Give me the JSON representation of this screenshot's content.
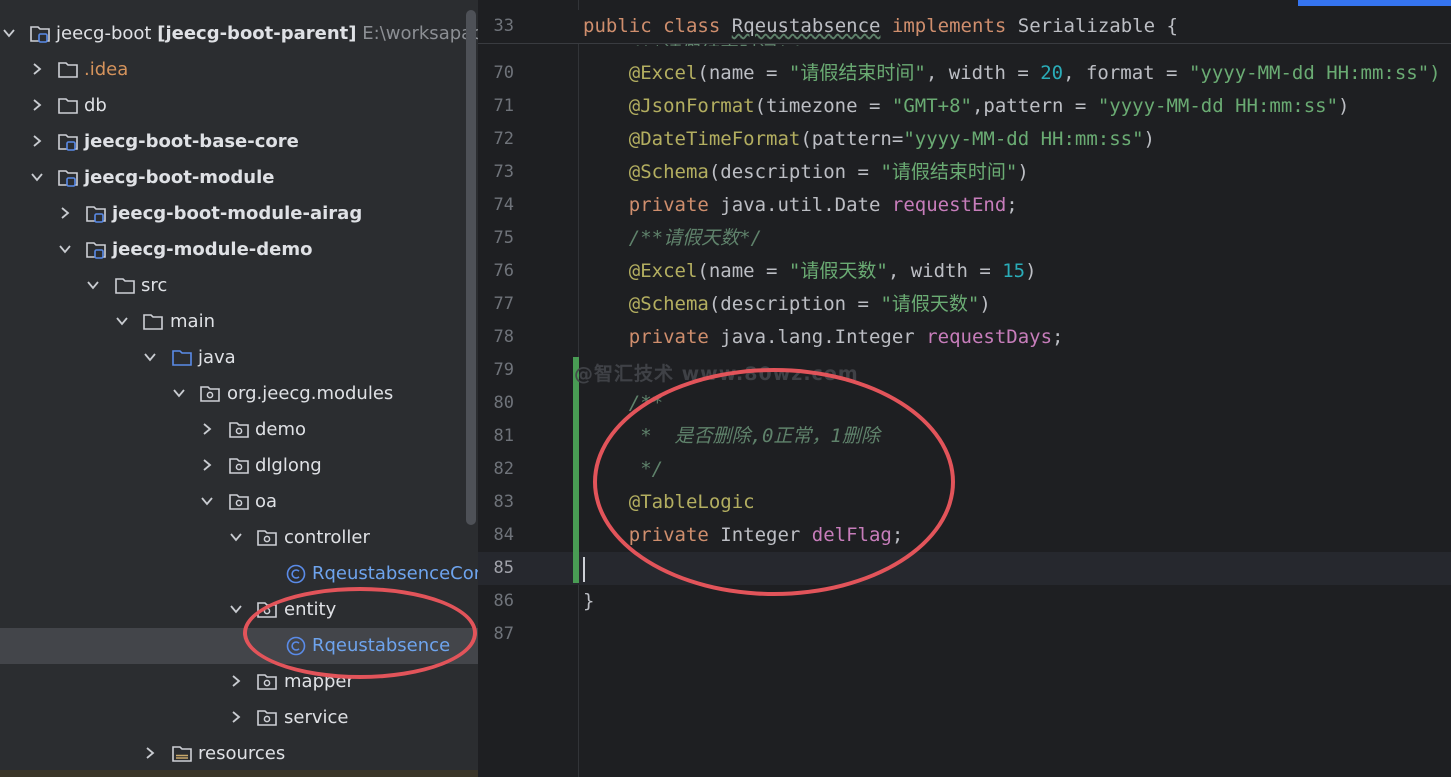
{
  "project_tree": {
    "items": [
      {
        "label": "jeecg-boot",
        "label_suffix": "[jeecg-boot-parent]",
        "path_hint": "E:\\worksapace\\je"
      },
      {
        "label": ".idea"
      },
      {
        "label": "db"
      },
      {
        "label": "jeecg-boot-base-core"
      },
      {
        "label": "jeecg-boot-module"
      },
      {
        "label": "jeecg-boot-module-airag"
      },
      {
        "label": "jeecg-module-demo"
      },
      {
        "label": "src"
      },
      {
        "label": "main"
      },
      {
        "label": "java"
      },
      {
        "label": "org.jeecg.modules"
      },
      {
        "label": "demo"
      },
      {
        "label": "dlglong"
      },
      {
        "label": "oa"
      },
      {
        "label": "controller"
      },
      {
        "label": "RqeustabsenceCont"
      },
      {
        "label": "entity"
      },
      {
        "label": "Rqeustabsence"
      },
      {
        "label": "mapper"
      },
      {
        "label": "service"
      },
      {
        "label": "resources"
      }
    ]
  },
  "editor": {
    "sticky_header": {
      "line_number": "33",
      "tokens": [
        "public",
        " ",
        "class",
        " ",
        "Rqeustabsence",
        " ",
        "implements",
        " ",
        "Serializable",
        " {"
      ]
    },
    "cut_line_text": "    /**请假结束时间*/",
    "lines": [
      {
        "num": "70",
        "tokens": [
          "    ",
          "@Excel",
          "(name = ",
          "\"请假结束时间\"",
          ", width = ",
          "20",
          ", format = ",
          "\"yyyy-MM-dd HH:mm:ss\")"
        ]
      },
      {
        "num": "71",
        "tokens": [
          "    ",
          "@JsonFormat",
          "(timezone = ",
          "\"GMT+8\"",
          ",pattern = ",
          "\"yyyy-MM-dd HH:mm:ss\"",
          ")"
        ]
      },
      {
        "num": "72",
        "tokens": [
          "    ",
          "@DateTimeFormat",
          "(pattern=",
          "\"yyyy-MM-dd HH:mm:ss\"",
          ")"
        ]
      },
      {
        "num": "73",
        "tokens": [
          "    ",
          "@Schema",
          "(description = ",
          "\"请假结束时间\"",
          ")"
        ]
      },
      {
        "num": "74",
        "tokens": [
          "    ",
          "private",
          " java.util.Date ",
          "requestEnd",
          ";"
        ]
      },
      {
        "num": "75",
        "tokens": [
          "    ",
          "/**请假天数*/"
        ]
      },
      {
        "num": "76",
        "tokens": [
          "    ",
          "@Excel",
          "(name = ",
          "\"请假天数\"",
          ", width = ",
          "15",
          ")"
        ]
      },
      {
        "num": "77",
        "tokens": [
          "    ",
          "@Schema",
          "(description = ",
          "\"请假天数\"",
          ")"
        ]
      },
      {
        "num": "78",
        "tokens": [
          "    ",
          "private",
          " java.lang.Integer ",
          "requestDays",
          ";"
        ]
      },
      {
        "num": "79",
        "tokens": [
          ""
        ]
      },
      {
        "num": "80",
        "tokens": [
          "    ",
          "/**"
        ]
      },
      {
        "num": "81",
        "tokens": [
          "     ",
          "*  是否删除,0正常，1删除"
        ]
      },
      {
        "num": "82",
        "tokens": [
          "     ",
          "*/"
        ]
      },
      {
        "num": "83",
        "tokens": [
          "    ",
          "@TableLogic"
        ]
      },
      {
        "num": "84",
        "tokens": [
          "    ",
          "private",
          " Integer ",
          "delFlag",
          ";"
        ]
      },
      {
        "num": "85",
        "tokens": [
          ""
        ]
      },
      {
        "num": "86",
        "tokens": [
          "}"
        ]
      },
      {
        "num": "87",
        "tokens": [
          ""
        ]
      }
    ],
    "watermark": "@智汇技术  www.80wz.com"
  },
  "colors": {
    "keyword": "#cf8e6d",
    "annotation": "#b3ae60",
    "string": "#6aab73",
    "number": "#2aacb8",
    "field": "#c77dbb",
    "comment": "#5f826b",
    "highlight_circle": "#e2545a"
  }
}
